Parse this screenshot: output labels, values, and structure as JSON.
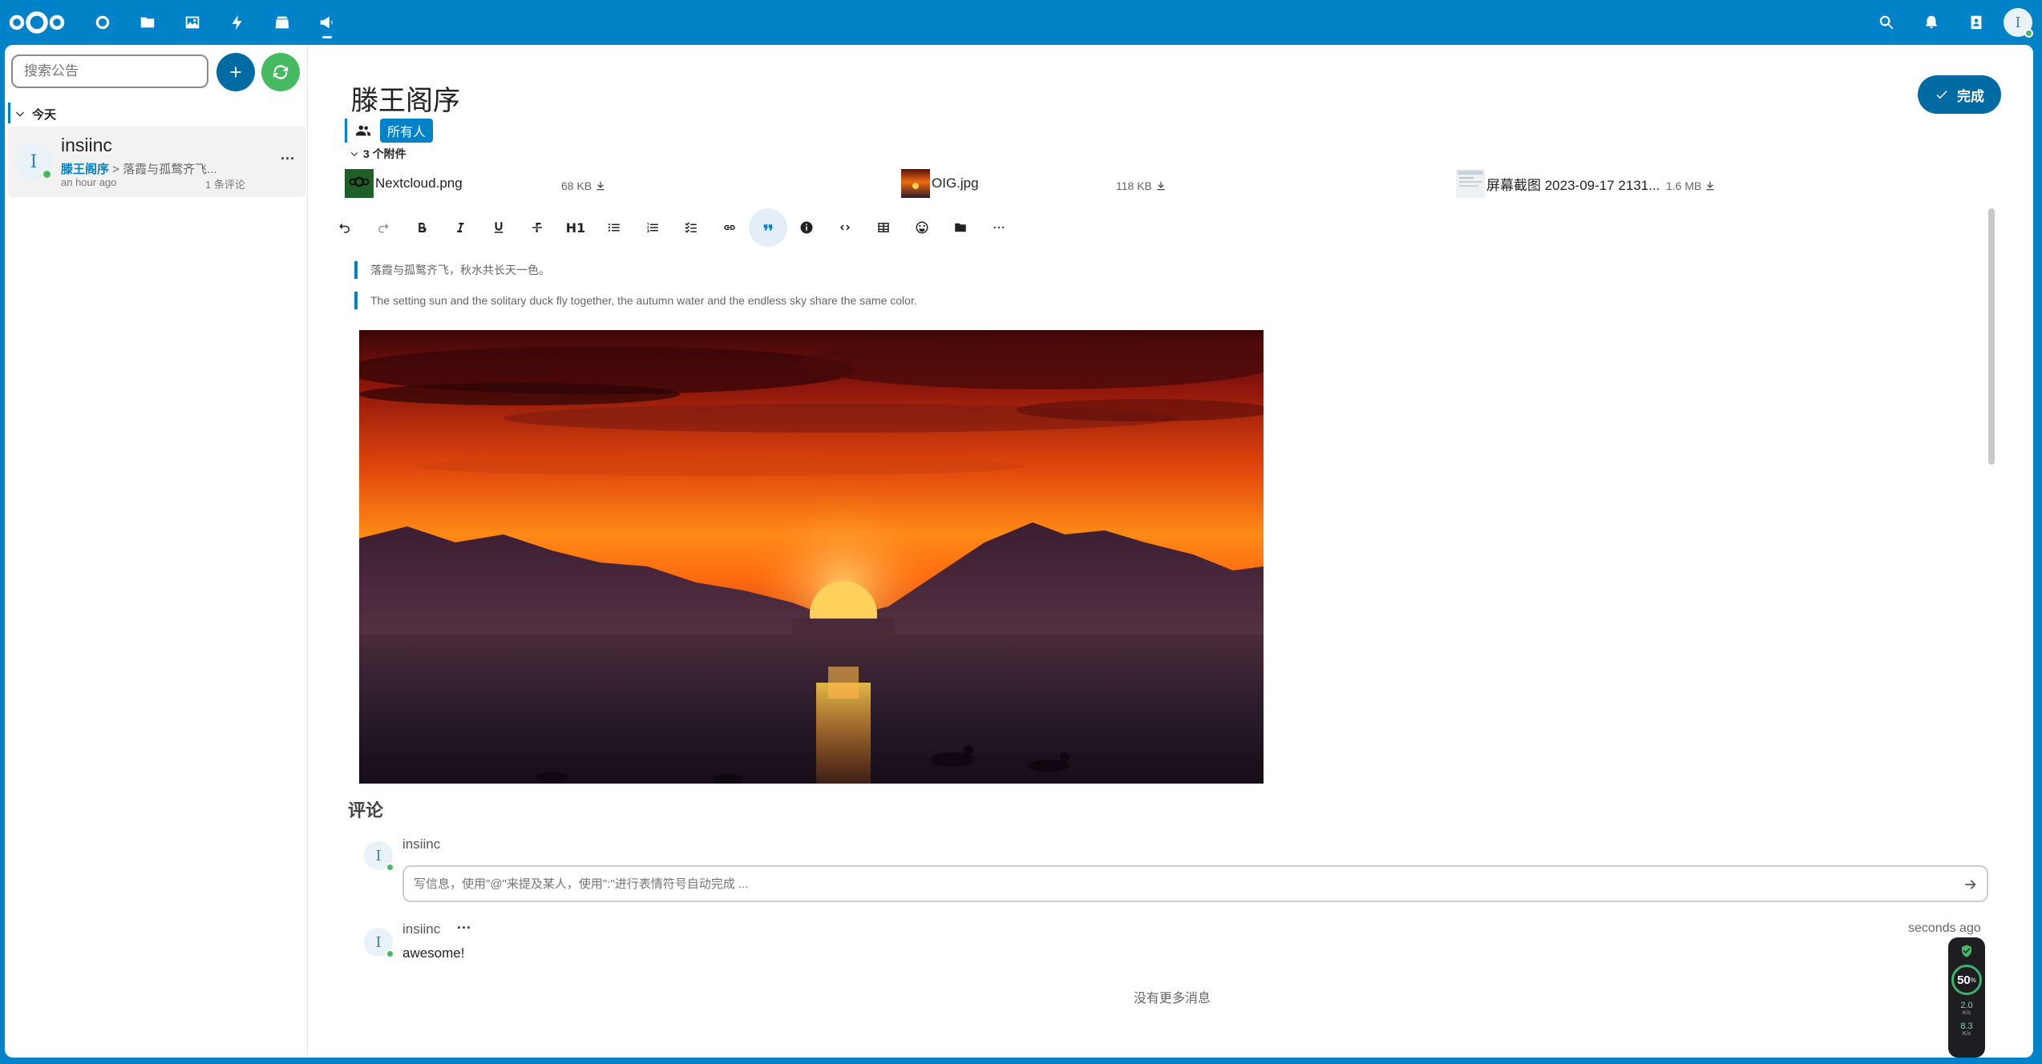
{
  "topbar": {
    "apps": [
      "dashboard-icon",
      "files-icon",
      "photos-icon",
      "activity-icon",
      "deck-icon",
      "announcements-icon"
    ],
    "user_initial": "I"
  },
  "sidebar": {
    "search_placeholder": "搜索公告",
    "group_label": "今天",
    "item": {
      "avatar_initial": "I",
      "title": "insiinc",
      "subtitle_link": "滕王阁序",
      "subtitle_rest": " > 落霞与孤鹜齐飞...",
      "time": "an hour ago",
      "comments": "1 条评论",
      "more": "···"
    }
  },
  "post": {
    "title": "滕王阁序",
    "done_label": "完成",
    "audience": "所有人",
    "attachments_header": "3 个附件",
    "attachments": [
      {
        "name": "Nextcloud.png",
        "size": "68 KB"
      },
      {
        "name": "OIG.jpg",
        "size": "118 KB"
      },
      {
        "name": "屏幕截图 2023-09-17 2131...",
        "size": "1.6 MB"
      }
    ],
    "toolbar": {
      "heading_label": "H1"
    },
    "quotes": [
      "落霞与孤鹜齐飞，秋水共长天一色。",
      "The setting sun and the solitary duck fly together, the autumn water and the endless sky share the same color."
    ]
  },
  "comments": {
    "title": "评论",
    "current_user": "insiinc",
    "avatar_initial": "I",
    "input_placeholder": "写信息，使用\"@\"来提及某人，使用\":\"进行表情符号自动完成 ...",
    "items": [
      {
        "author": "insiinc",
        "time": "seconds ago",
        "text": "awesome!",
        "more": "···"
      }
    ],
    "no_more": "没有更多消息"
  },
  "widget": {
    "percent": "50",
    "percent_unit": "%",
    "up": "2.0",
    "up_unit": "K/s",
    "down": "8.3",
    "down_unit": "K/s"
  },
  "colors": {
    "primary": "#0082c9",
    "primary_dark": "#006aa3",
    "success": "#46ba61"
  }
}
